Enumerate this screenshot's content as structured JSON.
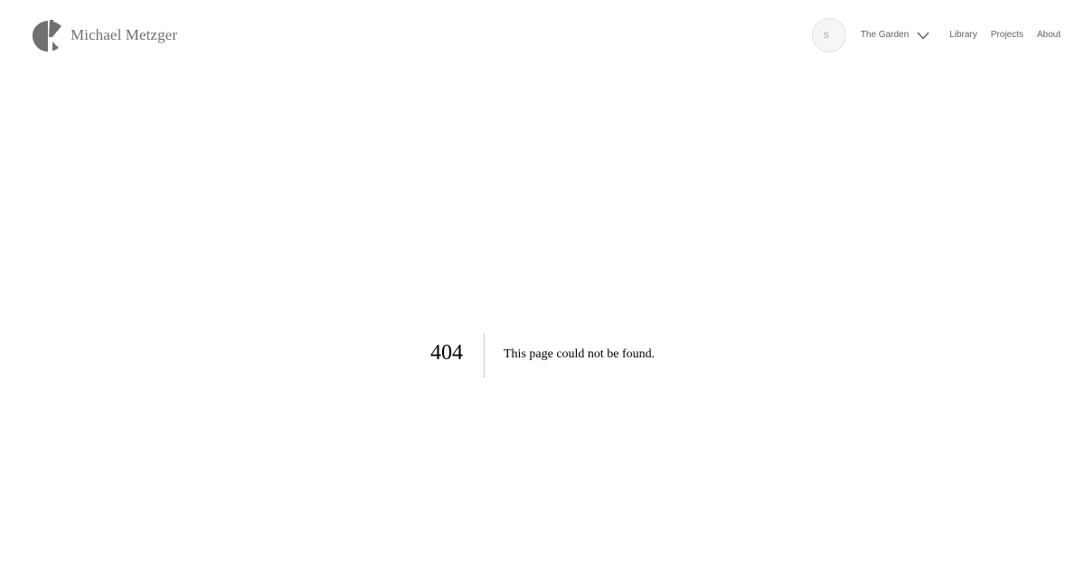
{
  "header": {
    "site_name": "Michael Metzger",
    "logo_icon": "k-logo-icon"
  },
  "nav": {
    "search": {
      "icon": "search-icon",
      "glyph": "S"
    },
    "items": [
      {
        "label": "The Garden",
        "has_dropdown": true
      },
      {
        "label": "Library"
      },
      {
        "label": "Projects"
      },
      {
        "label": "About"
      }
    ]
  },
  "error": {
    "code": "404",
    "message": "This page could not be found."
  },
  "colors": {
    "logo": "#707070",
    "nav_text": "#5f5f5f",
    "error_text": "#000000",
    "divider": "#c9c9c9"
  }
}
